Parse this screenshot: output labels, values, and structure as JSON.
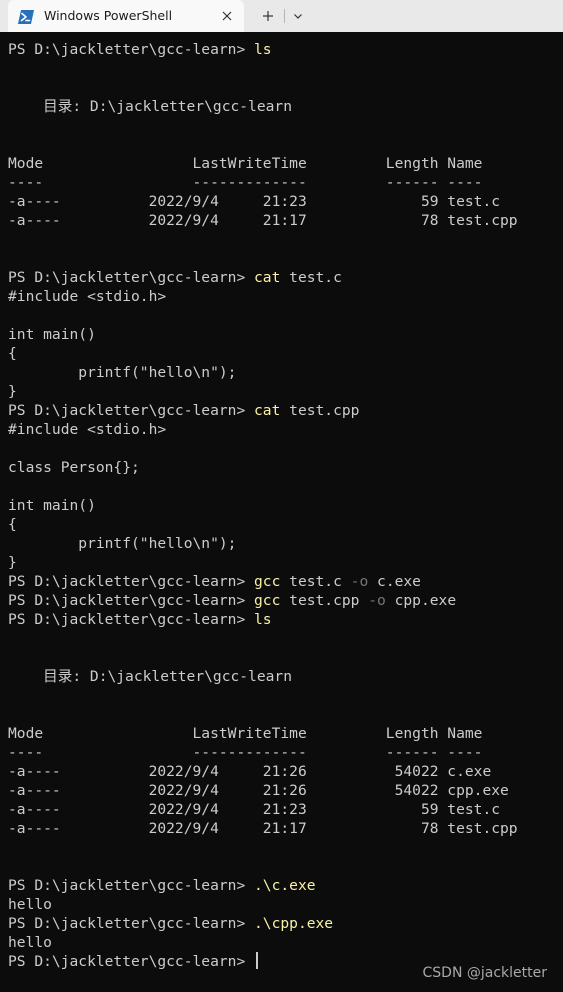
{
  "app": {
    "tab_title": "Windows PowerShell",
    "tab_icon": "powershell-icon",
    "close_icon": "close-icon",
    "new_tab_icon": "plus-icon",
    "dropdown_icon": "chevron-down-icon"
  },
  "colors": {
    "background": "#0c0c0c",
    "text": "#cccccc",
    "command": "#f9f1a5",
    "parameter": "#767676",
    "titlebar": "#e9e9e9",
    "tab": "#f9f9f9"
  },
  "terminal": {
    "lines": [
      [
        {
          "t": "PS D:\\jackletter\\gcc-learn> "
        },
        {
          "t": "ls",
          "c": "cmd"
        }
      ],
      [],
      [],
      [
        {
          "t": "    目录: D:\\jackletter\\gcc-learn"
        }
      ],
      [],
      [],
      [
        {
          "t": "Mode                 LastWriteTime         Length Name"
        }
      ],
      [
        {
          "t": "----                 -------------         ------ ----"
        }
      ],
      [
        {
          "t": "-a----          2022/9/4     21:23             59 test.c"
        }
      ],
      [
        {
          "t": "-a----          2022/9/4     21:17             78 test.cpp"
        }
      ],
      [],
      [],
      [
        {
          "t": "PS D:\\jackletter\\gcc-learn> "
        },
        {
          "t": "cat",
          "c": "cmd"
        },
        {
          "t": " test.c"
        }
      ],
      [
        {
          "t": "#include <stdio.h>"
        }
      ],
      [],
      [
        {
          "t": "int main()"
        }
      ],
      [
        {
          "t": "{"
        }
      ],
      [
        {
          "t": "        printf(\"hello\\n\");"
        }
      ],
      [
        {
          "t": "}"
        }
      ],
      [
        {
          "t": "PS D:\\jackletter\\gcc-learn> "
        },
        {
          "t": "cat",
          "c": "cmd"
        },
        {
          "t": " test.cpp"
        }
      ],
      [
        {
          "t": "#include <stdio.h>"
        }
      ],
      [],
      [
        {
          "t": "class Person{};"
        }
      ],
      [],
      [
        {
          "t": "int main()"
        }
      ],
      [
        {
          "t": "{"
        }
      ],
      [
        {
          "t": "        printf(\"hello\\n\");"
        }
      ],
      [
        {
          "t": "}"
        }
      ],
      [
        {
          "t": "PS D:\\jackletter\\gcc-learn> "
        },
        {
          "t": "gcc",
          "c": "cmd"
        },
        {
          "t": " test.c "
        },
        {
          "t": "-o",
          "c": "param"
        },
        {
          "t": " c.exe"
        }
      ],
      [
        {
          "t": "PS D:\\jackletter\\gcc-learn> "
        },
        {
          "t": "gcc",
          "c": "cmd"
        },
        {
          "t": " test.cpp "
        },
        {
          "t": "-o",
          "c": "param"
        },
        {
          "t": " cpp.exe"
        }
      ],
      [
        {
          "t": "PS D:\\jackletter\\gcc-learn> "
        },
        {
          "t": "ls",
          "c": "cmd"
        }
      ],
      [],
      [],
      [
        {
          "t": "    目录: D:\\jackletter\\gcc-learn"
        }
      ],
      [],
      [],
      [
        {
          "t": "Mode                 LastWriteTime         Length Name"
        }
      ],
      [
        {
          "t": "----                 -------------         ------ ----"
        }
      ],
      [
        {
          "t": "-a----          2022/9/4     21:26          54022 c.exe"
        }
      ],
      [
        {
          "t": "-a----          2022/9/4     21:26          54022 cpp.exe"
        }
      ],
      [
        {
          "t": "-a----          2022/9/4     21:23             59 test.c"
        }
      ],
      [
        {
          "t": "-a----          2022/9/4     21:17             78 test.cpp"
        }
      ],
      [],
      [],
      [
        {
          "t": "PS D:\\jackletter\\gcc-learn> "
        },
        {
          "t": ".\\c.exe",
          "c": "cmd"
        }
      ],
      [
        {
          "t": "hello"
        }
      ],
      [
        {
          "t": "PS D:\\jackletter\\gcc-learn> "
        },
        {
          "t": ".\\cpp.exe",
          "c": "cmd"
        }
      ],
      [
        {
          "t": "hello"
        }
      ],
      [
        {
          "t": "PS D:\\jackletter\\gcc-learn> "
        },
        {
          "cursor": true
        }
      ]
    ]
  },
  "watermark": "CSDN @jackletter"
}
